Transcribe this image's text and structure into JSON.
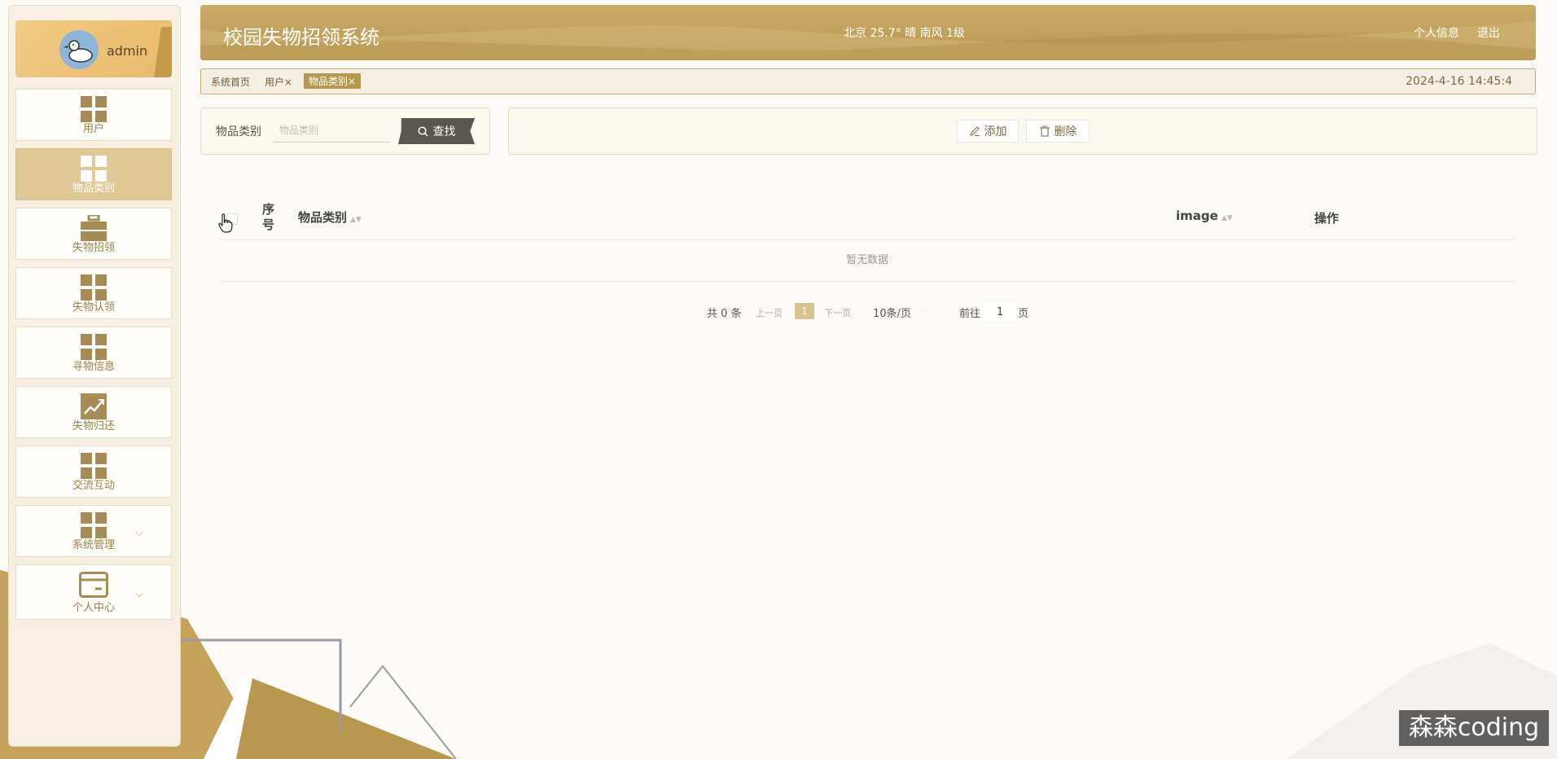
{
  "user": {
    "name": "admin"
  },
  "sidebar": {
    "items": [
      {
        "label": "用户"
      },
      {
        "label": "物品类别"
      },
      {
        "label": "失物招领"
      },
      {
        "label": "失物认领"
      },
      {
        "label": "寻物信息"
      },
      {
        "label": "失物归还"
      },
      {
        "label": "交流互动"
      },
      {
        "label": "系统管理"
      },
      {
        "label": "个人中心"
      }
    ],
    "active_index": 1
  },
  "header": {
    "title": "校园失物招领系统",
    "weather": "北京 25.7° 晴 南风 1级",
    "profile_link": "个人信息",
    "logout_link": "退出"
  },
  "tabs": {
    "items": [
      {
        "label": "系统首页"
      },
      {
        "label": "用户×"
      },
      {
        "label": "物品类别×"
      }
    ],
    "datetime": "2024-4-16 14:45:4"
  },
  "search": {
    "label": "物品类别",
    "placeholder": "物品类别",
    "button": "查找"
  },
  "actions": {
    "add": "添加",
    "delete": "删除"
  },
  "table": {
    "columns": [
      "序号",
      "物品类别",
      "image",
      "操作"
    ],
    "rows": [],
    "empty_text": "暂无数据"
  },
  "pagination": {
    "total": "共 0 条",
    "prev": "上一页",
    "current": "1",
    "next": "下一页",
    "page_size": "10条/页",
    "goto_label": "前往",
    "goto_value": "1",
    "page_suffix": "页"
  },
  "watermark": "森森coding",
  "colors": {
    "accent": "#b89850",
    "active_nav": "#dec996",
    "search_button": "#5a5650"
  }
}
